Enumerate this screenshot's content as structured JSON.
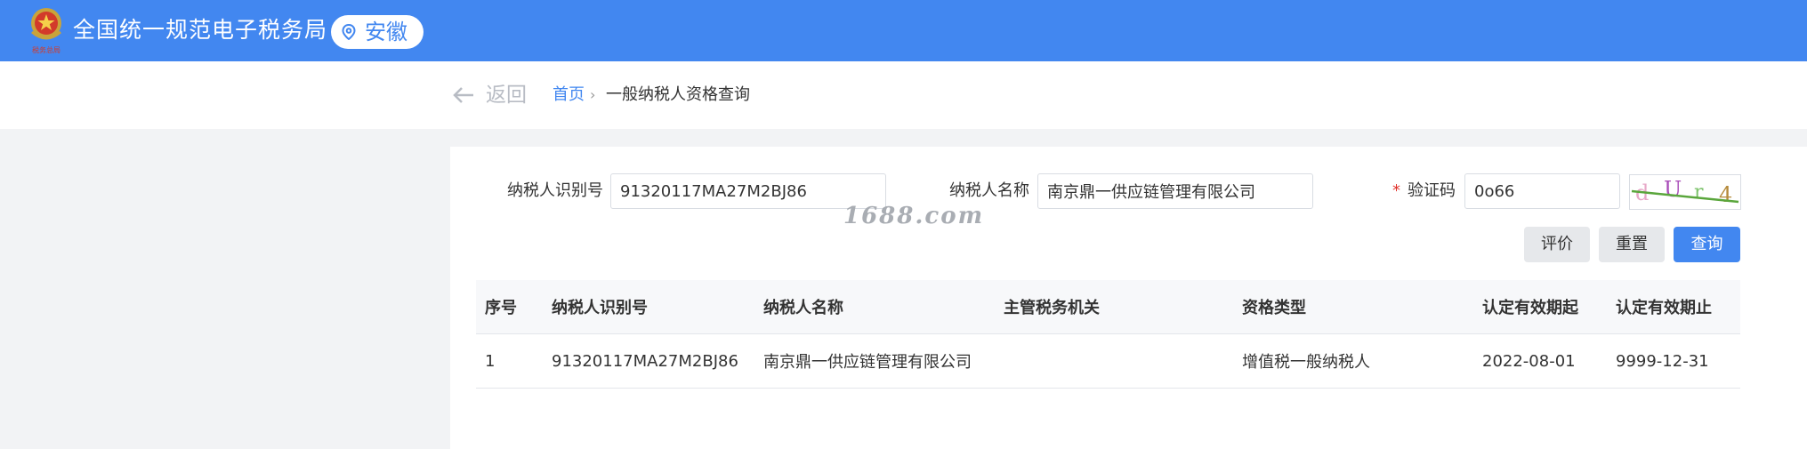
{
  "header": {
    "site_title": "全国统一规范电子税务局",
    "region": "安徽",
    "emblem_text": "税务总局",
    "bg_color": "#4287f0"
  },
  "nav": {
    "back_label": "返回",
    "breadcrumb_home": "首页",
    "breadcrumb_sep": "›",
    "breadcrumb_current": "一般纳税人资格查询"
  },
  "form": {
    "taxpayer_id_label": "纳税人识别号",
    "taxpayer_id_value": "91320117MA27M2BJ86",
    "taxpayer_name_label": "纳税人名称",
    "taxpayer_name_value": "南京鼎一供应链管理有限公司",
    "captcha_required": "*",
    "captcha_label": "验证码",
    "captcha_value": "0o66",
    "captcha_image_text": "dUr4"
  },
  "buttons": {
    "rate": "评价",
    "reset": "重置",
    "query": "查询"
  },
  "watermark": "1688.com",
  "table": {
    "headers": [
      "序号",
      "纳税人识别号",
      "纳税人名称",
      "主管税务机关",
      "资格类型",
      "认定有效期起",
      "认定有效期止"
    ],
    "rows": [
      [
        "1",
        "91320117MA27M2BJ86",
        "南京鼎一供应链管理有限公司",
        "",
        "增值税一般纳税人",
        "2022-08-01",
        "9999-12-31"
      ]
    ]
  }
}
